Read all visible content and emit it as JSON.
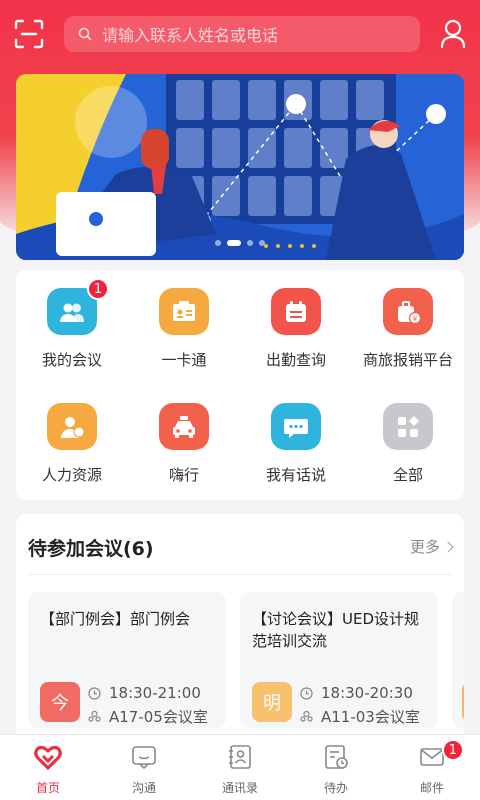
{
  "header": {
    "search_placeholder": "请输入联系人姓名或电话"
  },
  "banner": {
    "dots": 4,
    "active_dot": 1
  },
  "apps": [
    {
      "label": "我的会议",
      "icon": "people-icon",
      "color": "#2fb4de",
      "badge": "1"
    },
    {
      "label": "一卡通",
      "icon": "id-card-icon",
      "color": "#f6a940",
      "badge": ""
    },
    {
      "label": "出勤查询",
      "icon": "calendar-icon",
      "color": "#f2544b",
      "badge": ""
    },
    {
      "label": "商旅报销平台",
      "icon": "luggage-icon",
      "color": "#f2614b",
      "badge": ""
    },
    {
      "label": "人力资源",
      "icon": "person-icon",
      "color": "#f6a940",
      "badge": ""
    },
    {
      "label": "嗨行",
      "icon": "taxi-icon",
      "color": "#f2614b",
      "badge": ""
    },
    {
      "label": "我有话说",
      "icon": "chat-bubble-icon",
      "color": "#2fb4de",
      "badge": ""
    },
    {
      "label": "全部",
      "icon": "all-apps-icon",
      "color": "#c7c7cc",
      "badge": ""
    }
  ],
  "meetings": {
    "title": "待参加会议(6)",
    "more": "更多",
    "items": [
      {
        "title": "【部门例会】部门例会",
        "day": "今",
        "day_color": "#f2544b",
        "time": "18:30-21:00",
        "room": "A17-05会议室"
      },
      {
        "title": "【讨论会议】UED设计规范培训交流",
        "day": "明",
        "day_color": "#f6b04a",
        "time": "18:30-20:30",
        "room": "A11-03会议室"
      }
    ]
  },
  "tabs": [
    {
      "label": "首页",
      "icon": "home-heart-icon",
      "badge": ""
    },
    {
      "label": "沟通",
      "icon": "chat-icon",
      "badge": ""
    },
    {
      "label": "通讯录",
      "icon": "contacts-icon",
      "badge": ""
    },
    {
      "label": "待办",
      "icon": "todo-icon",
      "badge": ""
    },
    {
      "label": "邮件",
      "icon": "mail-icon",
      "badge": "1"
    }
  ]
}
